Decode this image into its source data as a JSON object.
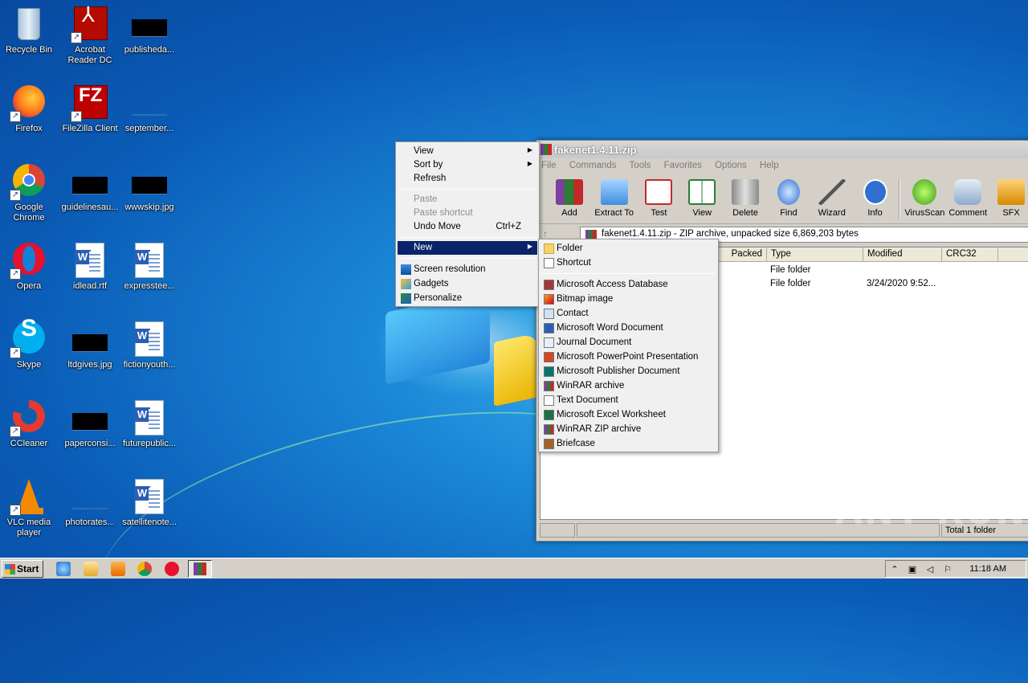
{
  "desktop_icons": [
    {
      "label": "Recycle Bin"
    },
    {
      "label": "Acrobat Reader DC"
    },
    {
      "label": "publisheda..."
    },
    {
      "label": "Firefox"
    },
    {
      "label": "FileZilla Client"
    },
    {
      "label": "september..."
    },
    {
      "label": "Google Chrome"
    },
    {
      "label": "guidelinesau..."
    },
    {
      "label": "wwwskip.jpg"
    },
    {
      "label": "Opera"
    },
    {
      "label": "idlead.rtf"
    },
    {
      "label": "expresstee..."
    },
    {
      "label": "Skype"
    },
    {
      "label": "ltdgives.jpg"
    },
    {
      "label": "fictionyouth..."
    },
    {
      "label": "CCleaner"
    },
    {
      "label": "paperconsi..."
    },
    {
      "label": "futurepublic..."
    },
    {
      "label": "VLC media player"
    },
    {
      "label": "photorates..."
    },
    {
      "label": "satellitenote..."
    }
  ],
  "winrar": {
    "title": "fakenet1.4.11.zip",
    "menu": [
      "File",
      "Commands",
      "Tools",
      "Favorites",
      "Options",
      "Help"
    ],
    "toolbar": [
      "Add",
      "Extract To",
      "Test",
      "View",
      "Delete",
      "Find",
      "Wizard",
      "Info",
      "VirusScan",
      "Comment",
      "SFX"
    ],
    "path": "fakenet1.4.11.zip - ZIP archive, unpacked size 6,869,203 bytes",
    "columns": [
      "Packed",
      "Type",
      "Modified",
      "CRC32"
    ],
    "rows": [
      {
        "type": "File folder",
        "modified": ""
      },
      {
        "type": "File folder",
        "modified": "3/24/2020 9:52..."
      }
    ],
    "status": "Total 1 folder"
  },
  "context_menu": {
    "view": "View",
    "sort_by": "Sort by",
    "refresh": "Refresh",
    "paste": "Paste",
    "paste_shortcut": "Paste shortcut",
    "undo_move": "Undo Move",
    "undo_shortcut": "Ctrl+Z",
    "new": "New",
    "screen_resolution": "Screen resolution",
    "gadgets": "Gadgets",
    "personalize": "Personalize"
  },
  "new_submenu": [
    "Folder",
    "Shortcut",
    "Microsoft Access Database",
    "Bitmap image",
    "Contact",
    "Microsoft Word Document",
    "Journal Document",
    "Microsoft PowerPoint Presentation",
    "Microsoft Publisher Document",
    "WinRAR archive",
    "Text Document",
    "Microsoft Excel Worksheet",
    "WinRAR ZIP archive",
    "Briefcase"
  ],
  "taskbar": {
    "start": "Start",
    "clock": "11:18 AM"
  },
  "watermark": "ANY RUN"
}
